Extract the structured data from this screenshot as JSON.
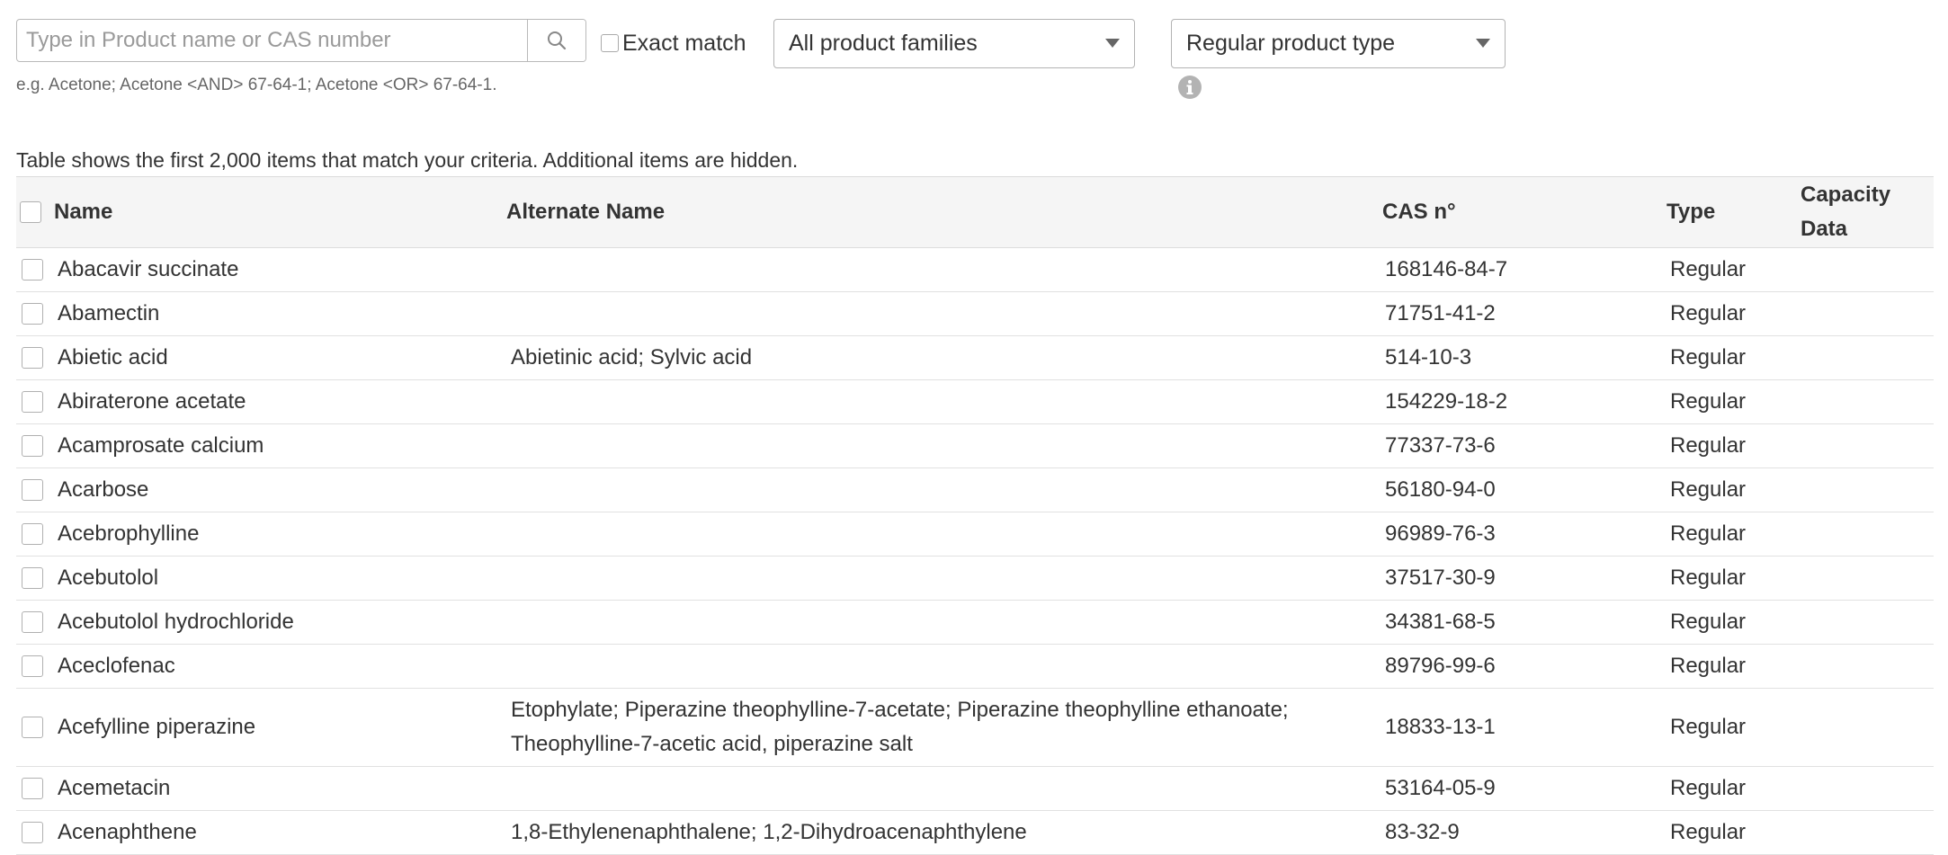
{
  "search": {
    "placeholder": "Type in Product name or CAS number",
    "value": "",
    "exact_match_label": "Exact match",
    "hint": "e.g. Acetone; Acetone <AND> 67-64-1; Acetone <OR> 67-64-1."
  },
  "filters": {
    "product_family": "All product families",
    "product_type": "Regular product type"
  },
  "table_note": "Table shows the first 2,000 items that match your criteria. Additional items are hidden.",
  "table": {
    "columns": [
      "Name",
      "Alternate Name",
      "CAS n°",
      "Type",
      "Capacity",
      "Data"
    ],
    "rows": [
      {
        "name": "Abacavir succinate",
        "alt": "",
        "cas": "168146-84-7",
        "type": "Regular"
      },
      {
        "name": "Abamectin",
        "alt": "",
        "cas": "71751-41-2",
        "type": "Regular"
      },
      {
        "name": "Abietic acid",
        "alt": "Abietinic acid; Sylvic acid",
        "cas": "514-10-3",
        "type": "Regular"
      },
      {
        "name": "Abiraterone acetate",
        "alt": "",
        "cas": "154229-18-2",
        "type": "Regular"
      },
      {
        "name": "Acamprosate calcium",
        "alt": "",
        "cas": "77337-73-6",
        "type": "Regular"
      },
      {
        "name": "Acarbose",
        "alt": "",
        "cas": "56180-94-0",
        "type": "Regular"
      },
      {
        "name": "Acebrophylline",
        "alt": "",
        "cas": "96989-76-3",
        "type": "Regular"
      },
      {
        "name": "Acebutolol",
        "alt": "",
        "cas": "37517-30-9",
        "type": "Regular"
      },
      {
        "name": "Acebutolol hydrochloride",
        "alt": "",
        "cas": "34381-68-5",
        "type": "Regular"
      },
      {
        "name": "Aceclofenac",
        "alt": "",
        "cas": "89796-99-6",
        "type": "Regular"
      },
      {
        "name": "Acefylline piperazine",
        "alt": "Etophylate; Piperazine theophylline-7-acetate; Piperazine theophylline ethanoate; Theophylline-7-acetic acid, piperazine salt",
        "cas": "18833-13-1",
        "type": "Regular"
      },
      {
        "name": "Acemetacin",
        "alt": "",
        "cas": "53164-05-9",
        "type": "Regular"
      },
      {
        "name": "Acenaphthene",
        "alt": "1,8-Ethylenenaphthalene; 1,2-Dihydroacenaphthylene",
        "cas": "83-32-9",
        "type": "Regular"
      }
    ]
  },
  "icons": {
    "search": "search-icon",
    "info": "info-icon",
    "dropdown": "chevron-down-icon"
  }
}
